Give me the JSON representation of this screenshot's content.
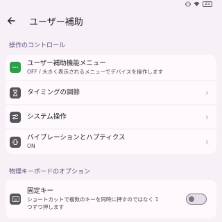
{
  "status": {
    "battery": "23"
  },
  "header": {
    "title": "ユーザー補助"
  },
  "sections": [
    {
      "header": "操作のコントロール",
      "items": [
        {
          "title": "ユーザー補助機能メニュー",
          "subtitle": "OFF / 大きく表示されるメニューでデバイスを操作します",
          "icon": "dots-menu-icon"
        },
        {
          "title": "タイミングの調節",
          "icon": "hourglass-icon"
        },
        {
          "title": "システム操作",
          "icon": "sliders-icon"
        },
        {
          "title": "バイブレーションとハプティクス",
          "subtitle": "ON",
          "icon": "vibration-icon"
        }
      ]
    },
    {
      "header": "物理キーボードのオプション",
      "items": [
        {
          "title": "固定キー",
          "subtitle_line1": "ショートカットで複数のキーを同時に押すのではなく 1",
          "subtitle_line2": "つずつ押します",
          "icon": "keyboard-icon",
          "toggle": false
        }
      ]
    }
  ],
  "colors": {
    "background": "#f7f0f6",
    "card": "#fdf9fd",
    "accent_green": "#2e9d4c",
    "icon_dark": "#57545c",
    "section_header": "#5b4f79"
  }
}
